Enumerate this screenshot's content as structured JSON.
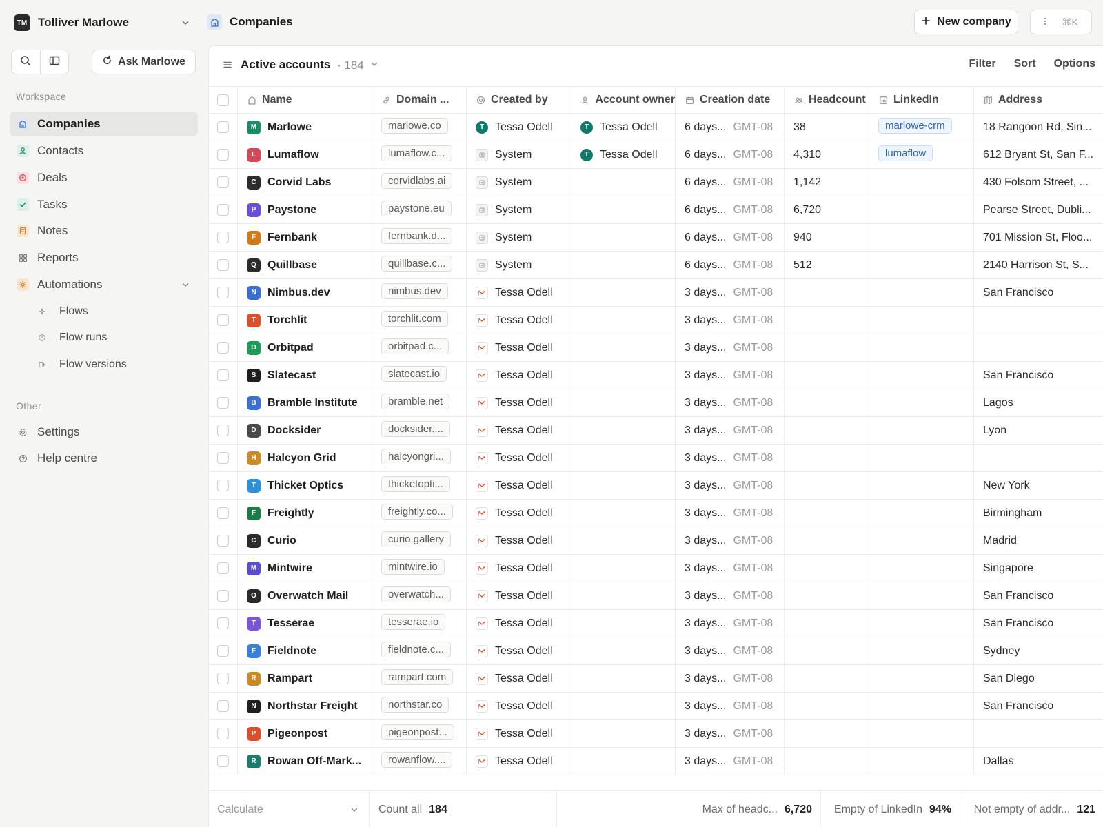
{
  "workspace": {
    "initials": "TM",
    "name": "Tolliver Marlowe"
  },
  "ask": {
    "label": "Ask Marlowe"
  },
  "sidebar": {
    "workspace_label": "Workspace",
    "other_label": "Other",
    "items": [
      {
        "label": "Companies",
        "icon": "building-icon",
        "color": "#3b6fd1",
        "bg": "#dfe7f5"
      },
      {
        "label": "Contacts",
        "icon": "person-icon",
        "color": "#1f8a6b",
        "bg": "#dcefe8"
      },
      {
        "label": "Deals",
        "icon": "target-icon",
        "color": "#d04a5a",
        "bg": "#f7dfe2"
      },
      {
        "label": "Tasks",
        "icon": "check-icon",
        "color": "#1f8a6b",
        "bg": "#dcefe8"
      },
      {
        "label": "Notes",
        "icon": "note-icon",
        "color": "#c98a2a",
        "bg": "#f6e8d0"
      },
      {
        "label": "Reports",
        "icon": "grid-icon",
        "color": "#6b6b69",
        "bg": "transparent"
      },
      {
        "label": "Automations",
        "icon": "gear-sun-icon",
        "color": "#d07a20",
        "bg": "#f7e5d0"
      }
    ],
    "sub_items": [
      {
        "label": "Flows",
        "icon": "sparkle-icon"
      },
      {
        "label": "Flow runs",
        "icon": "clock-icon"
      },
      {
        "label": "Flow versions",
        "icon": "version-icon"
      }
    ],
    "other_items": [
      {
        "label": "Settings",
        "icon": "settings-icon"
      },
      {
        "label": "Help centre",
        "icon": "help-icon"
      }
    ]
  },
  "header": {
    "title": "Companies",
    "new_label": "New company",
    "shortcut": "⌘K"
  },
  "view": {
    "title": "Active accounts",
    "count": "· 184",
    "actions": [
      "Filter",
      "Sort",
      "Options"
    ]
  },
  "columns": [
    "Name",
    "Domain ...",
    "Created by",
    "Account owner",
    "Creation date",
    "Headcount",
    "LinkedIn",
    "Address"
  ],
  "rows": [
    {
      "name": "Marlowe",
      "initial": "M",
      "color": "#1f8a6b",
      "domain": "marlowe.co",
      "creator": "Tessa Odell",
      "creator_type": "user",
      "owner": "Tessa Odell",
      "date": "6 days...",
      "tz": "GMT-08",
      "headcount": "38",
      "linkedin": "marlowe-crm",
      "address": "18 Rangoon Rd, Sin..."
    },
    {
      "name": "Lumaflow",
      "initial": "L",
      "color": "#d04a5a",
      "domain": "lumaflow.c...",
      "creator": "System",
      "creator_type": "system",
      "owner": "Tessa Odell",
      "date": "6 days...",
      "tz": "GMT-08",
      "headcount": "4,310",
      "linkedin": "lumaflow",
      "address": "612 Bryant St, San F..."
    },
    {
      "name": "Corvid Labs",
      "initial": "C",
      "color": "#2b2b2b",
      "domain": "corvidlabs.ai",
      "creator": "System",
      "creator_type": "system",
      "owner": "",
      "date": "6 days...",
      "tz": "GMT-08",
      "headcount": "1,142",
      "linkedin": "",
      "address": "430 Folsom Street, ..."
    },
    {
      "name": "Paystone",
      "initial": "P",
      "color": "#6a4fd6",
      "domain": "paystone.eu",
      "creator": "System",
      "creator_type": "system",
      "owner": "",
      "date": "6 days...",
      "tz": "GMT-08",
      "headcount": "6,720",
      "linkedin": "",
      "address": "Pearse Street, Dubli..."
    },
    {
      "name": "Fernbank",
      "initial": "F",
      "color": "#d07a20",
      "domain": "fernbank.d...",
      "creator": "System",
      "creator_type": "system",
      "owner": "",
      "date": "6 days...",
      "tz": "GMT-08",
      "headcount": "940",
      "linkedin": "",
      "address": "701 Mission St, Floo..."
    },
    {
      "name": "Quillbase",
      "initial": "Q",
      "color": "#2b2b2b",
      "domain": "quillbase.c...",
      "creator": "System",
      "creator_type": "system",
      "owner": "",
      "date": "6 days...",
      "tz": "GMT-08",
      "headcount": "512",
      "linkedin": "",
      "address": "2140 Harrison St, S..."
    },
    {
      "name": "Nimbus.dev",
      "initial": "N",
      "color": "#3b6fd1",
      "domain": "nimbus.dev",
      "creator": "Tessa Odell",
      "creator_type": "mail",
      "owner": "",
      "date": "3 days...",
      "tz": "GMT-08",
      "headcount": "",
      "linkedin": "",
      "address": "San Francisco"
    },
    {
      "name": "Torchlit",
      "initial": "T",
      "color": "#d9502f",
      "domain": "torchlit.com",
      "creator": "Tessa Odell",
      "creator_type": "mail",
      "owner": "",
      "date": "3 days...",
      "tz": "GMT-08",
      "headcount": "",
      "linkedin": "",
      "address": ""
    },
    {
      "name": "Orbitpad",
      "initial": "O",
      "color": "#1f9a5a",
      "domain": "orbitpad.c...",
      "creator": "Tessa Odell",
      "creator_type": "mail",
      "owner": "",
      "date": "3 days...",
      "tz": "GMT-08",
      "headcount": "",
      "linkedin": "",
      "address": ""
    },
    {
      "name": "Slatecast",
      "initial": "S",
      "color": "#1f1f1f",
      "domain": "slatecast.io",
      "creator": "Tessa Odell",
      "creator_type": "mail",
      "owner": "",
      "date": "3 days...",
      "tz": "GMT-08",
      "headcount": "",
      "linkedin": "",
      "address": "San Francisco"
    },
    {
      "name": "Bramble Institute",
      "initial": "B",
      "color": "#3b6fd1",
      "domain": "bramble.net",
      "creator": "Tessa Odell",
      "creator_type": "mail",
      "owner": "",
      "date": "3 days...",
      "tz": "GMT-08",
      "headcount": "",
      "linkedin": "",
      "address": "Lagos"
    },
    {
      "name": "Docksider",
      "initial": "D",
      "color": "#4a4a48",
      "domain": "docksider....",
      "creator": "Tessa Odell",
      "creator_type": "mail",
      "owner": "",
      "date": "3 days...",
      "tz": "GMT-08",
      "headcount": "",
      "linkedin": "",
      "address": "Lyon"
    },
    {
      "name": "Halcyon Grid",
      "initial": "H",
      "color": "#c98a2a",
      "domain": "halcyongri...",
      "creator": "Tessa Odell",
      "creator_type": "mail",
      "owner": "",
      "date": "3 days...",
      "tz": "GMT-08",
      "headcount": "",
      "linkedin": "",
      "address": ""
    },
    {
      "name": "Thicket Optics",
      "initial": "T",
      "color": "#2f8fd6",
      "domain": "thicketopti...",
      "creator": "Tessa Odell",
      "creator_type": "mail",
      "owner": "",
      "date": "3 days...",
      "tz": "GMT-08",
      "headcount": "",
      "linkedin": "",
      "address": "New York"
    },
    {
      "name": "Freightly",
      "initial": "F",
      "color": "#1f7a4a",
      "domain": "freightly.co...",
      "creator": "Tessa Odell",
      "creator_type": "mail",
      "owner": "",
      "date": "3 days...",
      "tz": "GMT-08",
      "headcount": "",
      "linkedin": "",
      "address": "Birmingham"
    },
    {
      "name": "Curio",
      "initial": "C",
      "color": "#2b2b2b",
      "domain": "curio.gallery",
      "creator": "Tessa Odell",
      "creator_type": "mail",
      "owner": "",
      "date": "3 days...",
      "tz": "GMT-08",
      "headcount": "",
      "linkedin": "",
      "address": "Madrid"
    },
    {
      "name": "Mintwire",
      "initial": "M",
      "color": "#5a4fc9",
      "domain": "mintwire.io",
      "creator": "Tessa Odell",
      "creator_type": "mail",
      "owner": "",
      "date": "3 days...",
      "tz": "GMT-08",
      "headcount": "",
      "linkedin": "",
      "address": "Singapore"
    },
    {
      "name": "Overwatch Mail",
      "initial": "O",
      "color": "#2b2b2b",
      "domain": "overwatch...",
      "creator": "Tessa Odell",
      "creator_type": "mail",
      "owner": "",
      "date": "3 days...",
      "tz": "GMT-08",
      "headcount": "",
      "linkedin": "",
      "address": "San Francisco"
    },
    {
      "name": "Tesserae",
      "initial": "T",
      "color": "#7a55d6",
      "domain": "tesserae.io",
      "creator": "Tessa Odell",
      "creator_type": "mail",
      "owner": "",
      "date": "3 days...",
      "tz": "GMT-08",
      "headcount": "",
      "linkedin": "",
      "address": "San Francisco"
    },
    {
      "name": "Fieldnote",
      "initial": "F",
      "color": "#3b7fd6",
      "domain": "fieldnote.c...",
      "creator": "Tessa Odell",
      "creator_type": "mail",
      "owner": "",
      "date": "3 days...",
      "tz": "GMT-08",
      "headcount": "",
      "linkedin": "",
      "address": "Sydney"
    },
    {
      "name": "Rampart",
      "initial": "R",
      "color": "#c98a2a",
      "domain": "rampart.com",
      "creator": "Tessa Odell",
      "creator_type": "mail",
      "owner": "",
      "date": "3 days...",
      "tz": "GMT-08",
      "headcount": "",
      "linkedin": "",
      "address": "San Diego"
    },
    {
      "name": "Northstar Freight",
      "initial": "N",
      "color": "#1f1f1f",
      "domain": "northstar.co",
      "creator": "Tessa Odell",
      "creator_type": "mail",
      "owner": "",
      "date": "3 days...",
      "tz": "GMT-08",
      "headcount": "",
      "linkedin": "",
      "address": "San Francisco"
    },
    {
      "name": "Pigeonpost",
      "initial": "P",
      "color": "#d9502f",
      "domain": "pigeonpost...",
      "creator": "Tessa Odell",
      "creator_type": "mail",
      "owner": "",
      "date": "3 days...",
      "tz": "GMT-08",
      "headcount": "",
      "linkedin": "",
      "address": ""
    },
    {
      "name": "Rowan Off-Mark...",
      "initial": "R",
      "color": "#1f7a6b",
      "domain": "rowanflow....",
      "creator": "Tessa Odell",
      "creator_type": "mail",
      "owner": "",
      "date": "3 days...",
      "tz": "GMT-08",
      "headcount": "",
      "linkedin": "",
      "address": "Dallas"
    }
  ],
  "footer": {
    "calculate": "Calculate",
    "count_label": "Count all",
    "count_value": "184",
    "max_label": "Max of headc...",
    "max_value": "6,720",
    "empty_label": "Empty of LinkedIn",
    "empty_value": "94%",
    "notempty_label": "Not empty of addr...",
    "notempty_value": "121"
  },
  "colors": {
    "accent": "#3b6fd1",
    "owner_avatar": "#127a6b",
    "linkedin_chip": "#2f64b3"
  }
}
